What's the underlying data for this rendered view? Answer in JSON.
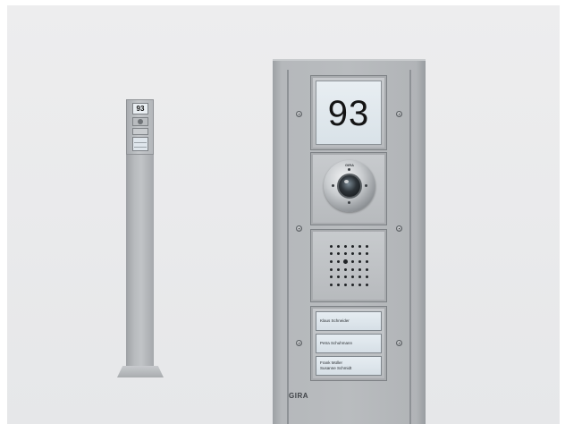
{
  "scene": {
    "house_number": "93",
    "camera_brand": "GIRA",
    "brand_label": "GIRA",
    "name_buttons": [
      {
        "line1": "Klaus Schneider",
        "line2": ""
      },
      {
        "line1": "Petra Schuhmann",
        "line2": ""
      },
      {
        "line1": "Frank Müller",
        "line2": "Susanne Schmidt"
      }
    ],
    "colors": {
      "background": "#e9eaec",
      "aluminium": "#b7babd",
      "nameplate": "#dfe6ec"
    }
  }
}
